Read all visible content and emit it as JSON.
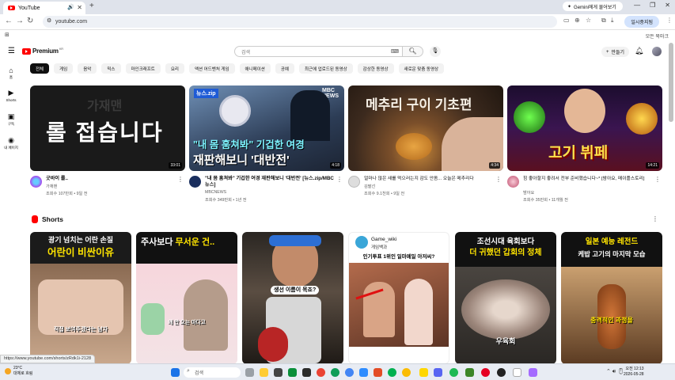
{
  "browser": {
    "tab_title": "YouTube",
    "new_tab": "+",
    "url": "youtube.com",
    "gemini_label": "Gemini에게 물어보기",
    "pause_label": "일시중지됨",
    "bookmarks_label": "모든 북마크"
  },
  "header": {
    "logo_text": "Premium",
    "logo_sup": "KR",
    "search_placeholder": "검색",
    "create_label": "만들기"
  },
  "chips": [
    "전체",
    "게임",
    "음악",
    "믹스",
    "마인크래프트",
    "요리",
    "액션 어드벤처 게임",
    "애니메이션",
    "공예",
    "최근에 업로드된 동영상",
    "감상한 동영상",
    "새로운 맞춤 동영상"
  ],
  "rail": [
    {
      "label": "홈",
      "icon": "home-icon"
    },
    {
      "label": "Shorts",
      "icon": "shorts-icon"
    },
    {
      "label": "구독",
      "icon": "subscriptions-icon"
    },
    {
      "label": "내 페이지",
      "icon": "you-icon"
    }
  ],
  "videos": [
    {
      "title": "굿바이 롤..",
      "channel": "가재맨",
      "meta": "조회수 107만회 • 9일 전",
      "duration": "33:01",
      "thumb_text": "롤 접습니다",
      "thumb_sub": "가재맨"
    },
    {
      "title": "\"내 몸 훔쳐봐\" 기겁한 여경 재판해보니 '대반전' [뉴스.zip/MBC 뉴스]",
      "channel": "MBCNEWS",
      "meta": "조회수 349만회 • 1년 전",
      "duration": "4:18",
      "thumb_text1": "\"내 몸 훔쳐봐\" 기겁한 여경",
      "thumb_text2": "재판해보니 '대반전'",
      "thumb_tag": "뉴스.zip",
      "thumb_logo": "MBC NEWS"
    },
    {
      "title": "얼마나 많은 새를 먹으러는지 감도 안옴... 오늘은 메추리다",
      "channel": "김팔선",
      "meta": "조회수 9.1천회 • 9일 전",
      "duration": "4:34",
      "thumb_text": "메추리 구이 기초편"
    },
    {
      "title": "힘 좋아할지 좋려서 전부 준비했습니다~* [밤아요, 메이플스토리]",
      "channel": "밤아요",
      "meta": "조회수 35만회 • 11개월 전",
      "duration": "14:21",
      "thumb_text": "고기 뷔페"
    }
  ],
  "shorts_title": "Shorts",
  "shorts": [
    {
      "top": "광기 넘치는 어란 손질",
      "main": "어란이 비싼이유",
      "bottom": "직접 보여주겠다는 남자"
    },
    {
      "top": "주사보다",
      "main": "무서운 건..",
      "bottom": "왜 안 오는 마다고"
    },
    {
      "bubble": "생선 이름이 목죠?"
    },
    {
      "handle": "Game_wiki",
      "sub": "게임백과",
      "headline": "인기투표 1위인 일마메일 아저씨?"
    },
    {
      "top": "조선시대 육회보다",
      "main": "더 귀했던 갑회의 정체",
      "bottom": "우육회"
    },
    {
      "top": "일본 예능 레전드",
      "main": "케밥 고기의 마지막 모습",
      "bottom": "충격적인 과정을"
    }
  ],
  "status_url": "https://www.youtube.com/shorts/zRdk1i-2128",
  "taskbar": {
    "temp": "23°C",
    "weather": "대체로 흐림",
    "search": "검색",
    "time": "오전 12:13",
    "date": "2026-05-28"
  },
  "colors": {
    "brand_red": "#ff0000",
    "chip_bg": "#f2f2f2",
    "text_secondary": "#606060"
  }
}
